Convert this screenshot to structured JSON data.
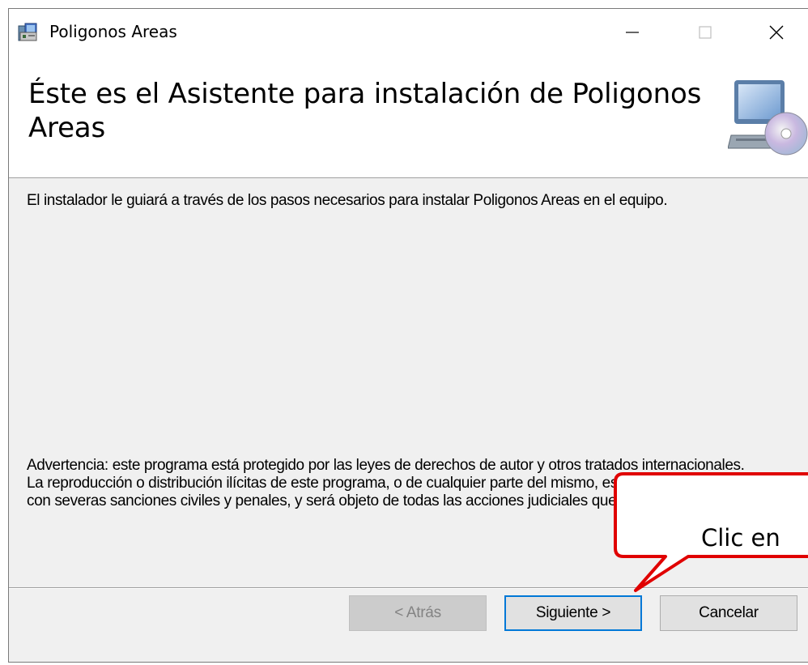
{
  "window": {
    "title": "Poligonos Areas",
    "controls": {
      "minimize": "—",
      "maximize": "☐",
      "close": "✕"
    }
  },
  "header": {
    "title": "Éste es el Asistente para instalación de Poligonos Areas",
    "icon": "computer-cd-icon"
  },
  "main": {
    "intro": "El instalador le guiará a través de los pasos necesarios para instalar Poligonos Areas en el equipo.",
    "warning": "Advertencia: este programa está protegido por las leyes de derechos de autor y otros tratados internacionales. La reproducción o distribución ilícitas de este programa, o de cualquier parte del mismo, está penada por la ley con severas sanciones civiles y penales, y será objeto de todas las acciones judiciales que correspondan."
  },
  "buttons": {
    "back": "< Atrás",
    "next": "Siguiente >",
    "cancel": "Cancelar"
  },
  "callout": {
    "text": "Clic en",
    "color": "#e00000"
  }
}
